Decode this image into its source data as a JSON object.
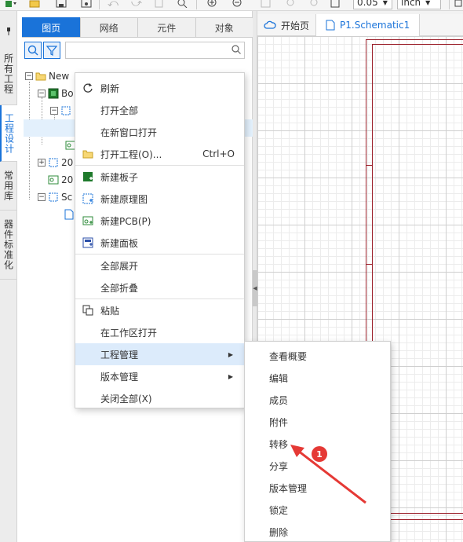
{
  "toolbar": {
    "zoom_value": "0.05",
    "unit_value": "inch"
  },
  "left_nav": {
    "items": [
      {
        "label": "所有工程"
      },
      {
        "label": "工程设计"
      },
      {
        "label": "常用库"
      },
      {
        "label": "器件标准化"
      }
    ]
  },
  "panel": {
    "tabs": [
      {
        "label": "图页"
      },
      {
        "label": "网络"
      },
      {
        "label": "元件"
      },
      {
        "label": "对象"
      }
    ],
    "search": {
      "value": "",
      "placeholder": ""
    },
    "tree": [
      {
        "label": "New"
      },
      {
        "label": "Bo"
      },
      {
        "label": ""
      },
      {
        "label": ""
      },
      {
        "label": ""
      },
      {
        "label": "20"
      },
      {
        "label": "20"
      },
      {
        "label": "Sc"
      },
      {
        "label": ""
      }
    ]
  },
  "doc_tabs": [
    {
      "label": "开始页",
      "icon": "cloud-icon"
    },
    {
      "label": "P1.Schematic1",
      "icon": "document-icon"
    }
  ],
  "context_menu": {
    "items": [
      {
        "label": "刷新",
        "icon": "refresh-icon",
        "shortcut": ""
      },
      {
        "label": "打开全部",
        "icon": "",
        "shortcut": ""
      },
      {
        "label": "在新窗口打开",
        "icon": "",
        "shortcut": ""
      },
      {
        "label": "打开工程(O)...",
        "icon": "folder-icon",
        "shortcut": "Ctrl+O"
      },
      {
        "label": "新建板子",
        "icon": "new-board-icon",
        "shortcut": ""
      },
      {
        "label": "新建原理图",
        "icon": "new-schematic-icon",
        "shortcut": ""
      },
      {
        "label": "新建PCB(P)",
        "icon": "new-pcb-icon",
        "shortcut": ""
      },
      {
        "label": "新建面板",
        "icon": "new-panel-icon",
        "shortcut": ""
      },
      {
        "label": "全部展开",
        "icon": "",
        "shortcut": ""
      },
      {
        "label": "全部折叠",
        "icon": "",
        "shortcut": ""
      },
      {
        "label": "粘贴",
        "icon": "paste-icon",
        "shortcut": ""
      },
      {
        "label": "在工作区打开",
        "icon": "",
        "shortcut": ""
      },
      {
        "label": "工程管理",
        "icon": "",
        "shortcut": "",
        "submenu": true,
        "highlighted": true
      },
      {
        "label": "版本管理",
        "icon": "",
        "shortcut": "",
        "submenu": true
      },
      {
        "label": "关闭全部(X)",
        "icon": "",
        "shortcut": ""
      }
    ]
  },
  "submenu": {
    "items": [
      {
        "label": "查看概要"
      },
      {
        "label": "编辑"
      },
      {
        "label": "成员"
      },
      {
        "label": "附件"
      },
      {
        "label": "转移"
      },
      {
        "label": "分享"
      },
      {
        "label": "版本管理"
      },
      {
        "label": "锁定"
      },
      {
        "label": "删除"
      }
    ]
  },
  "annotation": {
    "badge_number": "1",
    "color": "#e53935"
  },
  "colors": {
    "accent": "#1a73d9",
    "frame": "#9b1f2a",
    "menu_highlight": "#dcebfb"
  }
}
